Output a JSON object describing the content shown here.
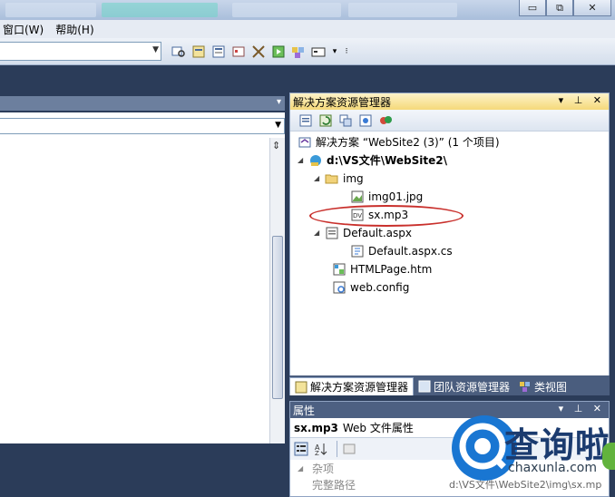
{
  "menu": {
    "items": [
      "窗口(W)",
      "帮助(H)"
    ]
  },
  "window_controls": {
    "minimize": "▭",
    "restore": "⧉",
    "close": "✕"
  },
  "solution_explorer": {
    "title": "解决方案资源管理器",
    "title_controls": "▾ ⊥ ✕",
    "tree": {
      "solution": "解决方案 “WebSite2 (3)” (1 个项目)",
      "project": "d:\\VS文件\\WebSite2\\",
      "folder_img": "img",
      "file_img01": "img01.jpg",
      "file_sx": "sx.mp3",
      "file_default": "Default.aspx",
      "file_default_cs": "Default.aspx.cs",
      "file_html": "HTMLPage.htm",
      "file_webconfig": "web.config"
    },
    "tabs": [
      "解决方案资源管理器",
      "团队资源管理器",
      "类视图"
    ]
  },
  "properties": {
    "title": "属性",
    "title_controls": "▾ ⊥ ✕",
    "object_name": "sx.mp3",
    "object_type": "Web 文件属性",
    "category": "杂项",
    "row_name": "完整路径",
    "row_value": "d:\\VS文件\\WebSite2\\img\\sx.mp"
  },
  "watermark": {
    "brand": "查询啦",
    "domain": "chaxunla.com"
  },
  "colors": {
    "accent_highlight": "#c9302c",
    "title_active": "#f5d97a",
    "panel_dark": "#2b3c59"
  }
}
